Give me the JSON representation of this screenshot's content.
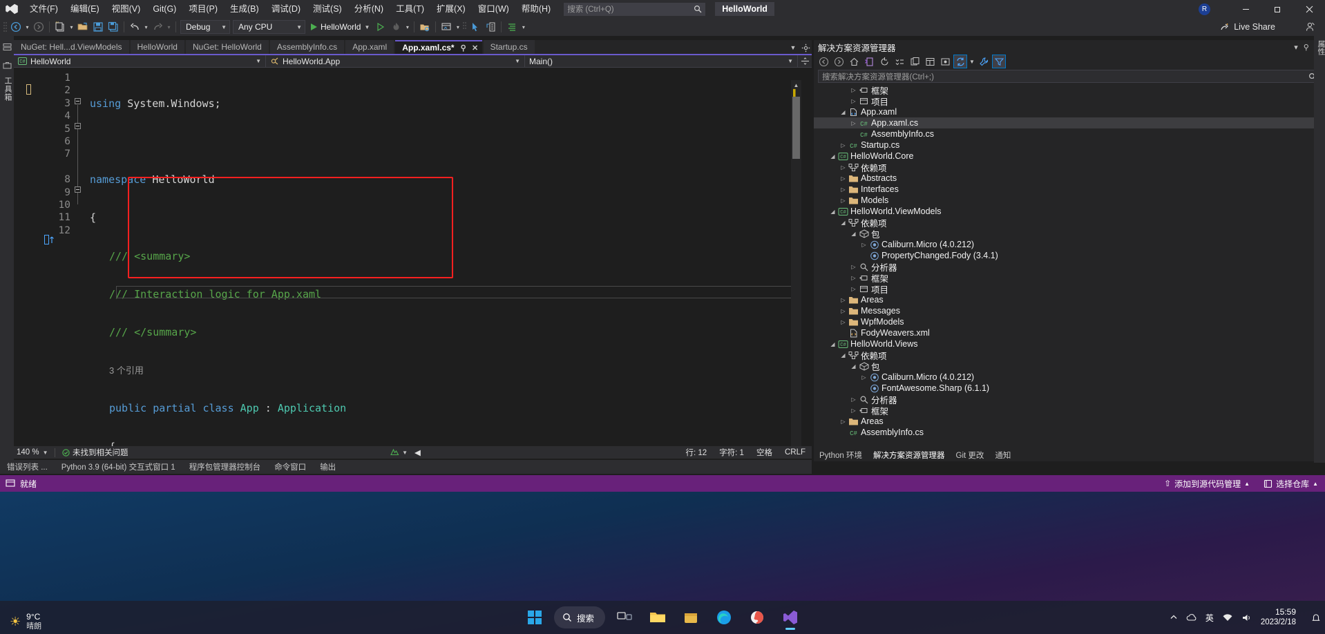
{
  "titlebar": {
    "menus": [
      "文件(F)",
      "编辑(E)",
      "视图(V)",
      "Git(G)",
      "项目(P)",
      "生成(B)",
      "调试(D)",
      "测试(S)",
      "分析(N)",
      "工具(T)",
      "扩展(X)",
      "窗口(W)",
      "帮助(H)"
    ],
    "search_placeholder": "搜索 (Ctrl+Q)",
    "solution_name": "HelloWorld",
    "account_initial": "R",
    "minimize": "—",
    "maximize": "❐",
    "close": "✕"
  },
  "toolbar": {
    "config": "Debug",
    "platform": "Any CPU",
    "run_target": "HelloWorld",
    "live_share": "Live Share"
  },
  "doc_tabs": [
    {
      "label": "NuGet: Hell...d.ViewModels",
      "active": false
    },
    {
      "label": "HelloWorld",
      "active": false
    },
    {
      "label": "NuGet: HelloWorld",
      "active": false
    },
    {
      "label": "AssemblyInfo.cs",
      "active": false
    },
    {
      "label": "App.xaml",
      "active": false
    },
    {
      "label": "App.xaml.cs*",
      "active": true,
      "pin": "⚲",
      "close": "✕"
    },
    {
      "label": "Startup.cs",
      "active": false
    }
  ],
  "nav_bar": {
    "project": "HelloWorld",
    "type": "HelloWorld.App",
    "member": "Main()"
  },
  "code": {
    "line_numbers": [
      "1",
      "2",
      "3",
      "4",
      "5",
      "6",
      "7",
      "8",
      "9",
      "10",
      "11",
      "12"
    ],
    "lines": [
      "using System.Windows;",
      "",
      "namespace HelloWorld",
      "{",
      "    /// <summary>",
      "    /// Interaction logic for App.xaml",
      "    /// </summary>",
      "    public partial class App : Application",
      "    {",
      "    }",
      "}",
      ""
    ],
    "codelens_reference": "3 个引用",
    "keyword_using": "using",
    "ns_system_windows": "System.Windows;",
    "keyword_namespace": "namespace",
    "ns_name": "HelloWorld",
    "comment_summary_open": "/// <summary>",
    "comment_text": "/// Interaction logic for App.xaml",
    "comment_summary_close": "/// </summary>",
    "kw_public": "public",
    "kw_partial": "partial",
    "kw_class": "class",
    "type_app": "App",
    "type_application": "Application"
  },
  "editor_status": {
    "zoom": "140 %",
    "error_text": "未找到相关问题",
    "line": "行: 12",
    "col": "字符: 1",
    "spaces": "空格",
    "eol": "CRLF"
  },
  "bottom_panel_tabs": [
    "错误列表 ...",
    "Python 3.9 (64-bit) 交互式窗口 1",
    "程序包管理器控制台",
    "命令窗口",
    "输出"
  ],
  "solution_explorer": {
    "title": "解决方案资源管理器",
    "search_placeholder": "搜索解决方案资源管理器(Ctrl+;)",
    "tabs": [
      {
        "label": "Python 环境",
        "active": false
      },
      {
        "label": "解决方案资源管理器",
        "active": true
      },
      {
        "label": "Git 更改",
        "active": false
      },
      {
        "label": "通知",
        "active": false
      }
    ],
    "tree": [
      {
        "label": "框架",
        "indent": 3,
        "arrow": "▷",
        "icon": "framework",
        "selected": false
      },
      {
        "label": "项目",
        "indent": 3,
        "arrow": "▷",
        "icon": "project",
        "selected": false
      },
      {
        "label": "App.xaml",
        "indent": 2,
        "arrow": "◢",
        "icon": "xaml",
        "selected": false
      },
      {
        "label": "App.xaml.cs",
        "indent": 3,
        "arrow": "▷",
        "icon": "cs",
        "selected": true
      },
      {
        "label": "AssemblyInfo.cs",
        "indent": 3,
        "arrow": "",
        "icon": "cs",
        "selected": false
      },
      {
        "label": "Startup.cs",
        "indent": 2,
        "arrow": "▷",
        "icon": "cs",
        "selected": false
      },
      {
        "label": "HelloWorld.Core",
        "indent": 1,
        "arrow": "◢",
        "icon": "csproj",
        "selected": false
      },
      {
        "label": "依赖项",
        "indent": 2,
        "arrow": "▷",
        "icon": "deps",
        "selected": false
      },
      {
        "label": "Abstracts",
        "indent": 2,
        "arrow": "▷",
        "icon": "folder",
        "selected": false
      },
      {
        "label": "Interfaces",
        "indent": 2,
        "arrow": "▷",
        "icon": "folder",
        "selected": false
      },
      {
        "label": "Models",
        "indent": 2,
        "arrow": "▷",
        "icon": "folder",
        "selected": false
      },
      {
        "label": "HelloWorld.ViewModels",
        "indent": 1,
        "arrow": "◢",
        "icon": "csproj",
        "selected": false
      },
      {
        "label": "依赖项",
        "indent": 2,
        "arrow": "◢",
        "icon": "deps",
        "selected": false
      },
      {
        "label": "包",
        "indent": 3,
        "arrow": "◢",
        "icon": "package",
        "selected": false
      },
      {
        "label": "Caliburn.Micro (4.0.212)",
        "indent": 4,
        "arrow": "▷",
        "icon": "nuget",
        "selected": false
      },
      {
        "label": "PropertyChanged.Fody (3.4.1)",
        "indent": 4,
        "arrow": "",
        "icon": "nuget",
        "selected": false
      },
      {
        "label": "分析器",
        "indent": 3,
        "arrow": "▷",
        "icon": "analyzer",
        "selected": false
      },
      {
        "label": "框架",
        "indent": 3,
        "arrow": "▷",
        "icon": "framework",
        "selected": false
      },
      {
        "label": "项目",
        "indent": 3,
        "arrow": "▷",
        "icon": "project",
        "selected": false
      },
      {
        "label": "Areas",
        "indent": 2,
        "arrow": "▷",
        "icon": "folder",
        "selected": false
      },
      {
        "label": "Messages",
        "indent": 2,
        "arrow": "▷",
        "icon": "folder",
        "selected": false
      },
      {
        "label": "WpfModels",
        "indent": 2,
        "arrow": "▷",
        "icon": "folder",
        "selected": false
      },
      {
        "label": "FodyWeavers.xml",
        "indent": 2,
        "arrow": "",
        "icon": "xml",
        "selected": false
      },
      {
        "label": "HelloWorld.Views",
        "indent": 1,
        "arrow": "◢",
        "icon": "csproj",
        "selected": false
      },
      {
        "label": "依赖项",
        "indent": 2,
        "arrow": "◢",
        "icon": "deps",
        "selected": false
      },
      {
        "label": "包",
        "indent": 3,
        "arrow": "◢",
        "icon": "package",
        "selected": false
      },
      {
        "label": "Caliburn.Micro (4.0.212)",
        "indent": 4,
        "arrow": "▷",
        "icon": "nuget",
        "selected": false
      },
      {
        "label": "FontAwesome.Sharp (6.1.1)",
        "indent": 4,
        "arrow": "",
        "icon": "nuget",
        "selected": false
      },
      {
        "label": "分析器",
        "indent": 3,
        "arrow": "▷",
        "icon": "analyzer",
        "selected": false
      },
      {
        "label": "框架",
        "indent": 3,
        "arrow": "▷",
        "icon": "framework",
        "selected": false
      },
      {
        "label": "Areas",
        "indent": 2,
        "arrow": "▷",
        "icon": "folder",
        "selected": false
      },
      {
        "label": "AssemblyInfo.cs",
        "indent": 2,
        "arrow": "",
        "icon": "cs",
        "selected": false
      }
    ]
  },
  "left_rail": {
    "tabs": [
      "工具箱"
    ]
  },
  "right_rail": {
    "tabs": [
      "属性"
    ]
  },
  "status_bar": {
    "ready": "就绪",
    "source_control": "添加到源代码管理",
    "repo": "选择仓库"
  },
  "taskbar": {
    "weather_temp": "9°C",
    "weather_desc": "晴朗",
    "search_label": "搜索",
    "time": "15:59",
    "date": "2023/2/18",
    "ime": "英"
  }
}
